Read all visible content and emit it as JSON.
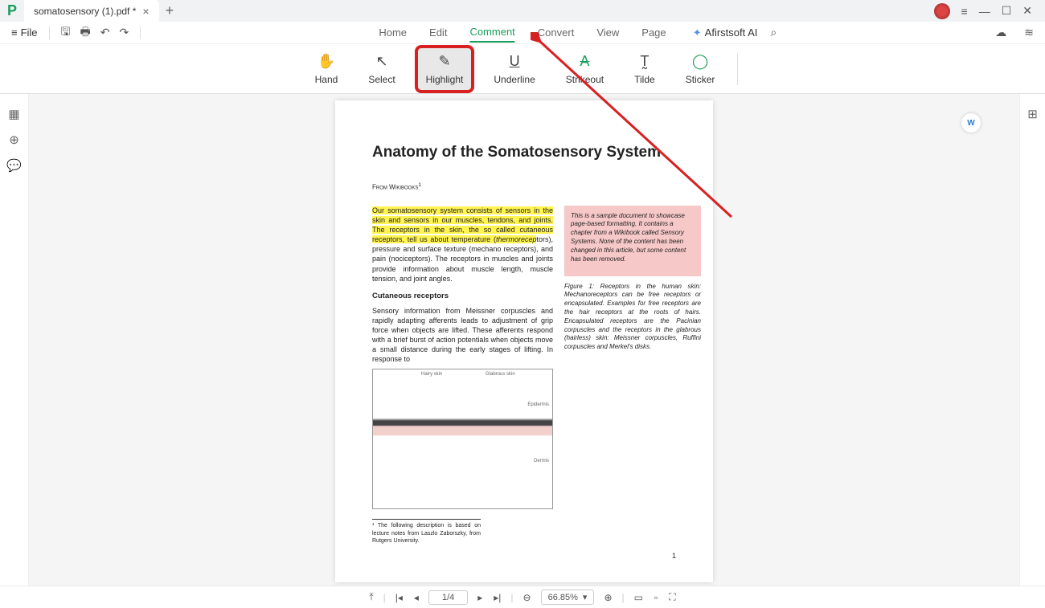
{
  "titlebar": {
    "tab_name": "somatosensory (1).pdf *",
    "win": {
      "min": "—",
      "max": "☐",
      "close": "✕"
    }
  },
  "menubar": {
    "file": "File",
    "nav": [
      "Home",
      "Edit",
      "Comment",
      "Convert",
      "View",
      "Page"
    ],
    "active_index": 2,
    "ai": "Afirstsoft AI"
  },
  "toolbar": {
    "items": [
      {
        "label": "Hand",
        "icon": "✋"
      },
      {
        "label": "Select",
        "icon": "↖"
      },
      {
        "label": "Highlight",
        "icon": "✎"
      },
      {
        "label": "Underline",
        "icon": "U"
      },
      {
        "label": "Strikeout",
        "icon": "A"
      },
      {
        "label": "Tilde",
        "icon": "T"
      },
      {
        "label": "Sticker",
        "icon": "◯"
      }
    ],
    "highlighted_index": 2
  },
  "document": {
    "title": "Anatomy of the Somatosensory System",
    "source": "From Wikibooks",
    "source_sup": "1",
    "para1_hl": "Our somatosensory system consists of sensors in the skin and sensors in our muscles, tendons, and joints. The receptors in the skin, the so called cutaneous receptors, tell us about temperature (",
    "para1_hl_italic": "thermorecep",
    "para1_rest": "tors), pressure and surface texture (mechano receptors), and pain (nociceptors). The receptors in muscles and joints provide information about muscle length, muscle tension, and joint angles.",
    "subhead": "Cutaneous receptors",
    "para2": "Sensory information from Meissner corpuscles and rapidly adapting afferents leads to adjustment of grip force when objects are lifted. These afferents respond with a brief burst of action potentials when objects move a small distance during the early stages of lifting. In response to",
    "sidebox": "This is a sample document to showcase page-based formatting. It contains a chapter from a Wikibook called Sensory Systems. None of the content has been changed in this article, but some content has been removed.",
    "fig_caption": "Figure 1: Receptors in the human skin: Mechanoreceptors can be free receptors or encapsulated. Examples for free receptors are the hair receptors at the roots of hairs. Encapsulated receptors are the Pacinian corpuscles and the receptors in the glabrous (hairless) skin: Meissner corpuscles, Ruffini corpuscles and Merkel's disks.",
    "diagram_labels": {
      "l1": "Hairy skin",
      "l2": "Glabrous skin",
      "l3": "Epidermis",
      "l4": "Dermis"
    },
    "footnote": "¹ The following description is based on lecture notes from Laszlo Zaborszky, from Rutgers University.",
    "page_number": "1"
  },
  "statusbar": {
    "page": "1/4",
    "zoom": "66.85%"
  },
  "annotation": {
    "highlight_box_color": "#d92020",
    "arrow_color": "#d92020"
  }
}
